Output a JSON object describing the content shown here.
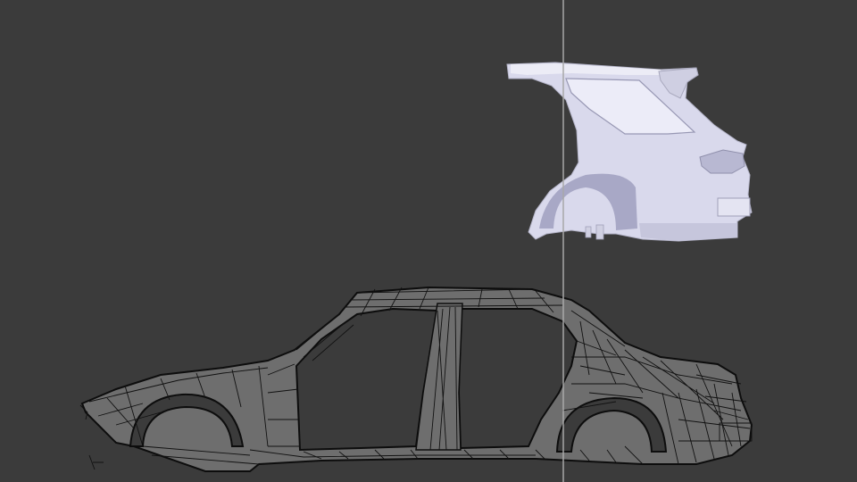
{
  "app": {
    "name": "3D viewport",
    "background_color": "#3b3b3b"
  },
  "objects": [
    {
      "name": "rear-quarter-panel",
      "display": "solid",
      "color": "#dcdcee",
      "window_color": "#eaeaf7",
      "shadow_color": "#a9a9c5"
    },
    {
      "name": "car-body-frame",
      "display": "wireframe",
      "fill_color": "#6d6d6d",
      "wire_color": "#101010"
    }
  ],
  "guide_line": {
    "color": "#a8a8a8"
  }
}
